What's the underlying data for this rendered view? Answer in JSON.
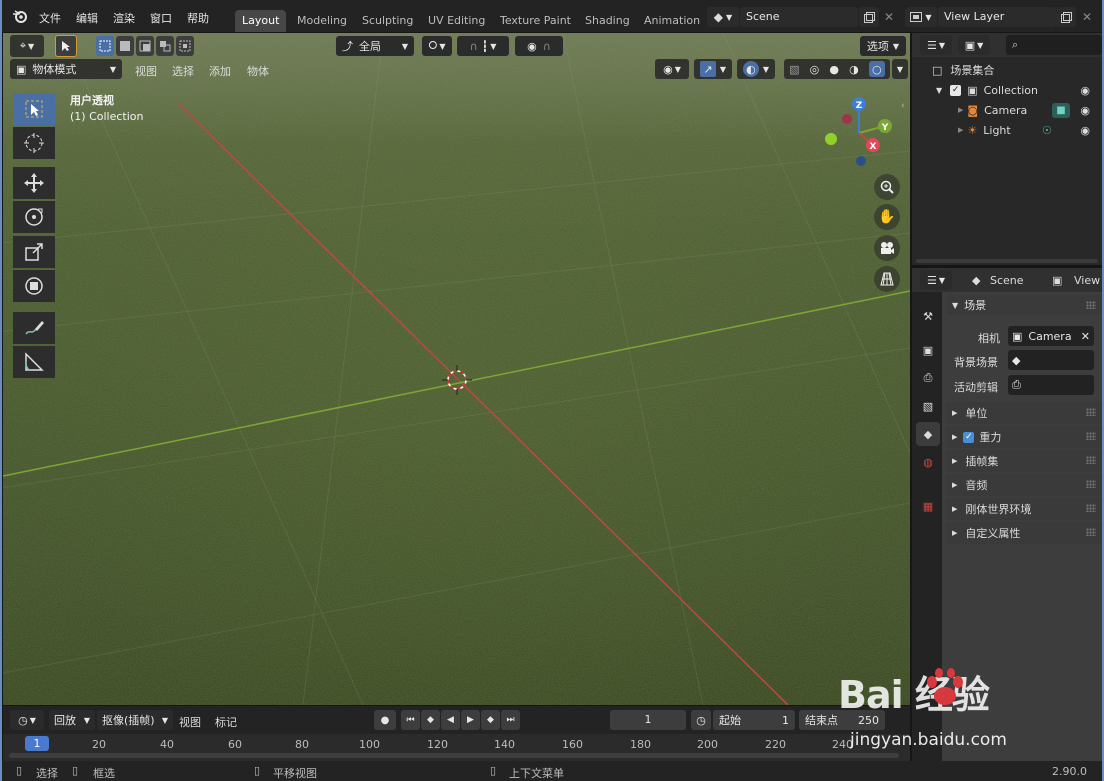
{
  "menu": {
    "file": "文件",
    "edit": "编辑",
    "render": "渲染",
    "window": "窗口",
    "help": "帮助"
  },
  "workspaces": [
    "Layout",
    "Modeling",
    "Sculpting",
    "UV Editing",
    "Texture Paint",
    "Shading",
    "Animation"
  ],
  "scene_field": "Scene",
  "view_layer_field": "View Layer",
  "viewport": {
    "transform_orient": "全局",
    "options": "选项",
    "mode": "物体模式",
    "menus": [
      "视图",
      "选择",
      "添加",
      "物体"
    ],
    "overlay_title": "用户透视",
    "overlay_collection": "(1) Collection",
    "gizmo_axes": {
      "z": "Z",
      "y": "Y",
      "x": "X"
    }
  },
  "outliner": {
    "root": "场景集合",
    "items": [
      "Collection",
      "Camera",
      "Light"
    ]
  },
  "properties": {
    "header_scene": "Scene",
    "header_view": "View",
    "section": "场景",
    "camera_label": "相机",
    "camera_value": "Camera",
    "bg_label": "背景场景",
    "clip_label": "活动剪辑",
    "panels": [
      "单位",
      "重力",
      "插帧集",
      "音频",
      "刚体世界环境",
      "自定义属性"
    ]
  },
  "timeline": {
    "playback": "回放",
    "keying": "抠像(插帧)",
    "view": "视图",
    "marker": "标记",
    "current_frame": "1",
    "start_label": "起始",
    "start_value": "1",
    "end_label": "结束点",
    "end_value": "250",
    "ruler": [
      "1",
      "20",
      "40",
      "60",
      "80",
      "100",
      "120",
      "140",
      "160",
      "180",
      "200",
      "220",
      "240"
    ]
  },
  "status": {
    "select": "选择",
    "box_select": "框选",
    "pan_view": "平移视图",
    "context_menu": "上下文菜单",
    "version": "2.90.0"
  },
  "watermark": {
    "brand": "Bai 经验",
    "url": "jingyan.baidu.com"
  },
  "colors": {
    "accent": "#4a6fa5",
    "x_axis": "#c24646",
    "y_axis": "#7ea637",
    "z_axis": "#3f7ed6"
  }
}
